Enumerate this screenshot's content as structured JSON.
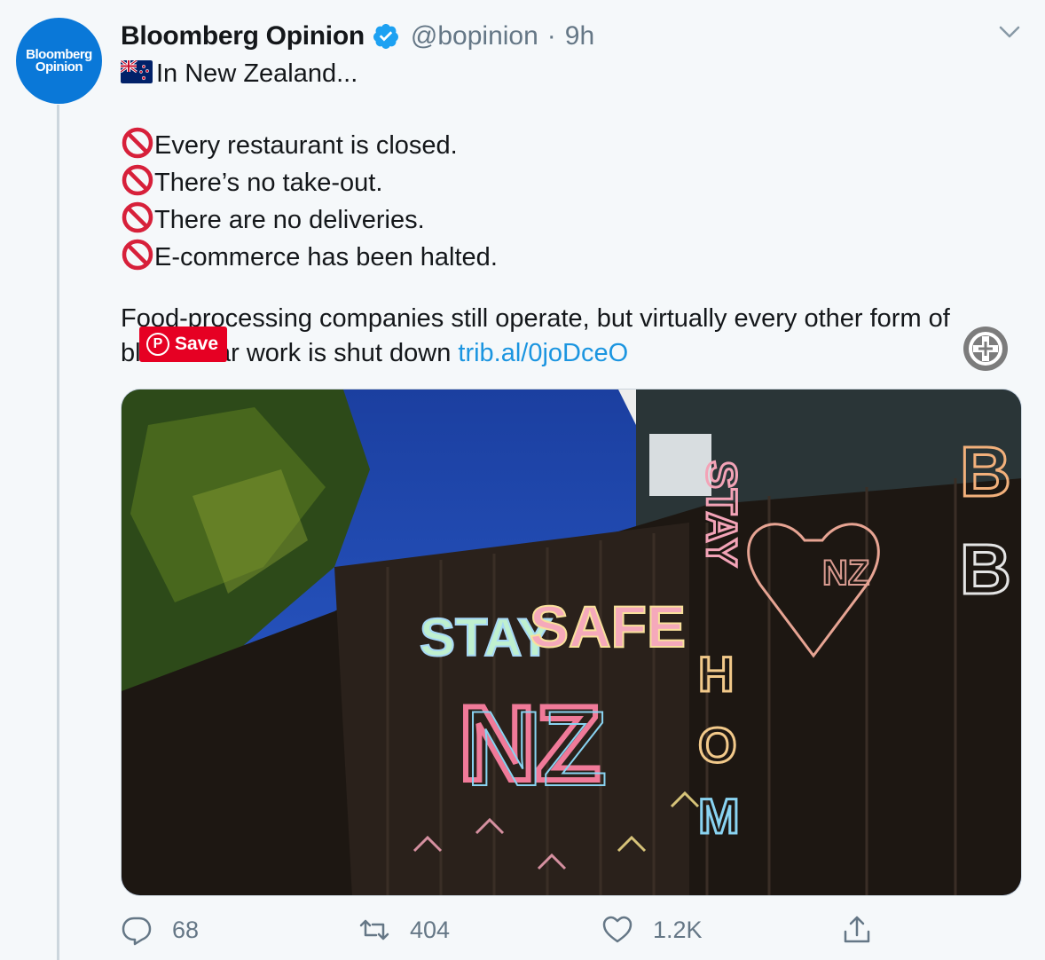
{
  "author": {
    "name": "Bloomberg Opinion",
    "handle": "@bopinion",
    "separator": "·",
    "time": "9h",
    "avatar_line1": "Bloomberg",
    "avatar_line2": "Opinion",
    "verified": true
  },
  "tweet": {
    "intro": "In New Zealand...",
    "bullets": [
      "Every restaurant is closed.",
      "There’s no take-out.",
      "There are no deliveries.",
      "E-commerce has been halted."
    ],
    "body_line1": "Food-processing companies still operate, but virtually every other form of",
    "body_line2": "blue-collar work is shut down ",
    "link": "trib.al/0joDceO"
  },
  "overlay": {
    "pinterest_label": "Save"
  },
  "media": {
    "chalk_text": [
      "STAY SAFE",
      "NZ",
      "STAY HOME",
      "NZ"
    ]
  },
  "actions": {
    "replies": "68",
    "retweets": "404",
    "likes": "1.2K"
  },
  "colors": {
    "brand": "#0a78d8",
    "link": "#1b95e0",
    "muted": "#657786",
    "pinterest": "#e60023"
  }
}
